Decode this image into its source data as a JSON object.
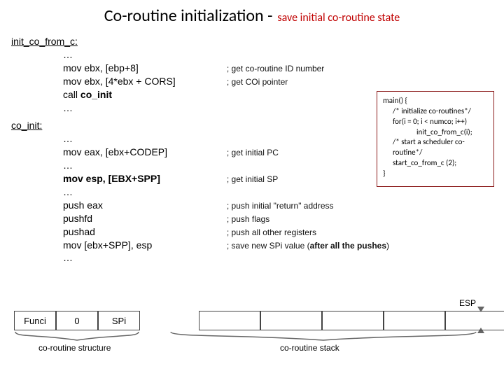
{
  "title": {
    "main": "Co-routine initialization -",
    "sub": "save initial co-routine state"
  },
  "sections": {
    "init_label": "init_co_from_c:",
    "coinit_label": "co_init:"
  },
  "init_block": {
    "l0": "…",
    "l1": {
      "i": "mov ebx, [ebp+8]",
      "c": "; get co-routine ID number"
    },
    "l2": {
      "i": "mov ebx, [4*ebx + CORS]",
      "c": "; get COi pointer"
    },
    "l3": "call ",
    "l3b": "co_init",
    "l4": "…"
  },
  "coinit_block": {
    "l0": "…",
    "l1": {
      "i": "mov eax, [ebx+CODEP]",
      "c": "; get initial PC"
    },
    "l2": "…",
    "l3": {
      "i": "mov esp, [EBX+SPP]",
      "c": "; get initial SP"
    },
    "l4": "…",
    "l5": {
      "i": "push eax",
      "c": "; push initial \"return\" address"
    },
    "l6": {
      "i": "pushfd",
      "c": "; push flags"
    },
    "l7": {
      "i": "pushad",
      "c": "; push all other registers"
    },
    "l8": {
      "i": "mov [ebx+SPP], esp",
      "c_a": "; save new SPi value (",
      "c_b": "after all the pushes",
      "c_c": ")"
    },
    "l9": "…"
  },
  "side": {
    "l0": "main() {",
    "l1": "/* initialize co-routines*/",
    "l2": "for(i = 0; i < numco; i++)",
    "l3": "init_co_from_c(i);",
    "l4": "/* start a scheduler co-routine*/",
    "l5": "start_co_from_c (2);",
    "l6": "}"
  },
  "diagram": {
    "struct_cells": {
      "c0": "Funci",
      "c1": "0",
      "c2": "SPi"
    },
    "struct_label": "co-routine structure",
    "stack_label": "co-routine stack",
    "esp": "ESP"
  }
}
